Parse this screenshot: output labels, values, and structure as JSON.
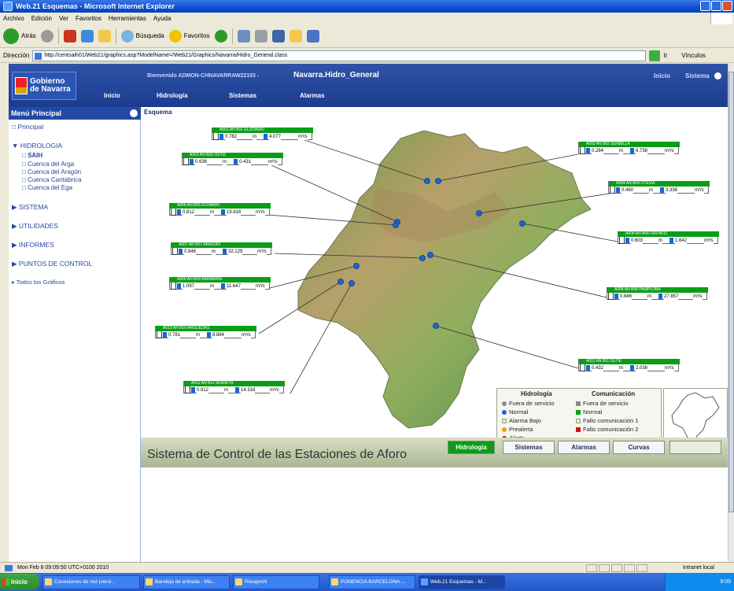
{
  "window": {
    "title": "Web.21 Esquemas - Microsoft Internet Explorer"
  },
  "menubar": [
    "Archivo",
    "Edición",
    "Ver",
    "Favoritos",
    "Herramientas",
    "Ayuda"
  ],
  "toolbar": {
    "back_label": "Atrás",
    "search_label": "Búsqueda",
    "favorites_label": "Favoritos"
  },
  "addressbar": {
    "label": "Dirección",
    "url": "http://centsaih01/Web21/graphics.asp?ModelName=/Web21/Graphics/Navarra/Hidro_General.class",
    "go_label": "Ir",
    "links_label": "Vínculos"
  },
  "app": {
    "logo_line1": "Gobierno",
    "logo_line2": "de Navarra",
    "welcome": "Bienvenido ADMON-CHNAVARRAW22103 -",
    "model_name": "Navarra.Hidro_General",
    "nav": [
      "Inicio",
      "Hidrología",
      "Sistemas",
      "Alarmas"
    ],
    "nav_right": [
      "Inicio",
      "Sistema"
    ],
    "section_label": "Esquema"
  },
  "sidebar": {
    "title": "Menú Principal",
    "items": [
      {
        "label": "Principal"
      },
      {
        "label": "HIDROLOGIA"
      },
      {
        "label": "SAIH"
      },
      {
        "label": "Cuenca del Arga"
      },
      {
        "label": "Cuenca del Aragón"
      },
      {
        "label": "Cuenca Cantábrica"
      },
      {
        "label": "Cuenca del Ega"
      },
      {
        "label": "SISTEMA"
      },
      {
        "label": "UTILIDADES"
      },
      {
        "label": "INFORMES"
      },
      {
        "label": "PUNTOS DE CONTROL"
      },
      {
        "label": "Todos los Gráficos"
      }
    ]
  },
  "stations": [
    {
      "name": "A001 AN B01 ELIZONDO",
      "level": "0.782",
      "flow": "4.077",
      "unit_level": "m",
      "unit_flow": "m³/s"
    },
    {
      "name": "A002 AN B02 SUNBILLA",
      "level": "0.284",
      "flow": "6.738",
      "unit_level": "m",
      "unit_flow": "m³/s"
    },
    {
      "name": "A003 AN B03 OSTIZ",
      "level": "0.636",
      "flow": "0.431",
      "unit_level": "m",
      "unit_flow": "m³/s"
    },
    {
      "name": "A004 AN B04 OTEIZA",
      "level": "0.460",
      "flow": "3.338",
      "unit_level": "m",
      "unit_flow": "m³/s"
    },
    {
      "name": "A005 AN B05 ECHARRI",
      "level": "0.812",
      "flow": "19.616",
      "unit_level": "m",
      "unit_flow": "m³/s"
    },
    {
      "name": "A006 AN B06 ORONOZ",
      "level": "0.603",
      "flow": "1.642",
      "unit_level": "m",
      "unit_flow": "m³/s"
    },
    {
      "name": "A007 AN B07 ARAZURI",
      "level": "0.846",
      "flow": "32.129",
      "unit_level": "m",
      "unit_flow": "m³/s"
    },
    {
      "name": "A008 AN B08 PAMPLONA",
      "level": "0.846",
      "flow": "27.857",
      "unit_level": "m",
      "unit_flow": "m³/s"
    },
    {
      "name": "A009 AN B09 BARBARIN",
      "level": "1.097",
      "flow": "11.647",
      "unit_level": "m",
      "unit_flow": "m³/s"
    },
    {
      "name": "A010 AN B10 ARGUEDAS",
      "level": "0.781",
      "flow": "8.884",
      "unit_level": "m",
      "unit_flow": "m³/s"
    },
    {
      "name": "A011 AN B11 OLITE",
      "level": "0.432",
      "flow": "2.038",
      "unit_level": "m",
      "unit_flow": "m³/s"
    },
    {
      "name": "A012 AN B12 MURIETA",
      "level": "0.912",
      "flow": "14.318",
      "unit_level": "m",
      "unit_flow": "m³/s"
    }
  ],
  "legend": {
    "hidro_title": "Hidrología",
    "com_title": "Comunicación",
    "hidro": [
      {
        "label": "Fuera de servicio",
        "color": "#8a8a8a"
      },
      {
        "label": "Normal",
        "color": "#1767d4"
      },
      {
        "label": "Alarma Bajo",
        "color": "#f3ef8f"
      },
      {
        "label": "Prealerta",
        "color": "#f39a12"
      },
      {
        "label": "Alerta",
        "color": "#d31010"
      }
    ],
    "com": [
      {
        "label": "Fuera de servicio",
        "color": "#8a8a8a"
      },
      {
        "label": "Normal",
        "color": "#0b9d18"
      },
      {
        "label": "Fallo comunicación 1",
        "color": "#f3ef8f"
      },
      {
        "label": "Fallo comunicación 2",
        "color": "#d31010"
      }
    ]
  },
  "footer": {
    "title": "Sistema de Control de las Estaciones de Aforo",
    "tabs": [
      "Hidrología",
      "Sistemas",
      "Alarmas",
      "Curvas"
    ]
  },
  "statusbar": {
    "text": "Mon Feb 8 09:09:50 UTC+0100 2010",
    "zone": "Intranet local"
  },
  "taskbar": {
    "start": "Inicio",
    "tasks": [
      "Conexiones de red (versi...",
      "Bandeja de entrada - Mic...",
      "RiesgosN",
      "PONENCIA BARCELONA ...",
      "Web.21 Esquemas - M..."
    ],
    "clock": "9:09"
  }
}
